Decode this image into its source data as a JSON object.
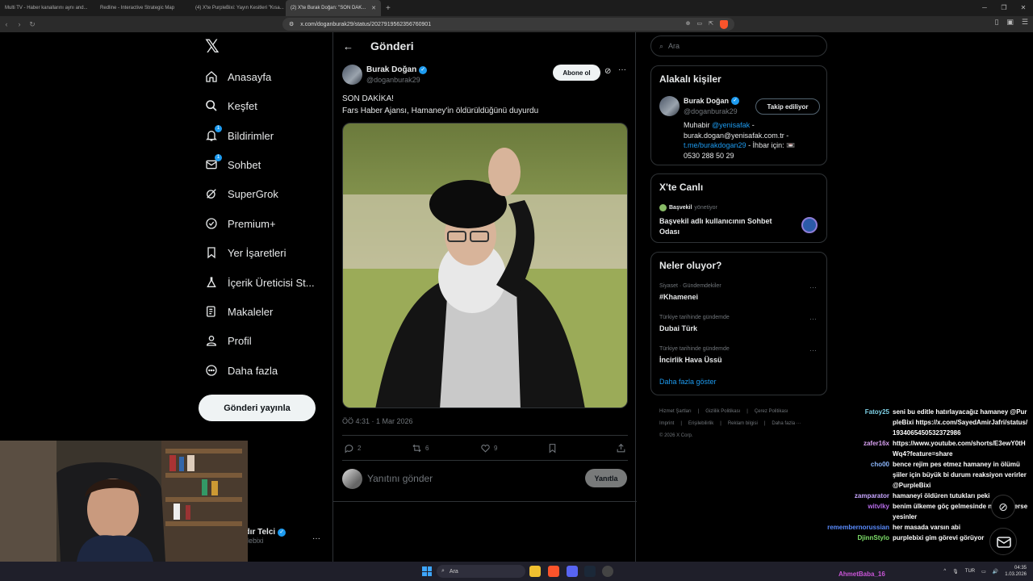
{
  "browser": {
    "tabs": [
      {
        "title": "Multi TV - Haber kanallarını aynı and...",
        "active": false
      },
      {
        "title": "Redline - Interactive Strategic Map",
        "active": false
      },
      {
        "title": "(4) X'te PurpleBixi: Yayın Kesitleri \"Kısa...",
        "active": false
      },
      {
        "title": "(2) X'te Burak Doğan: \"SON DAK...",
        "active": true
      }
    ],
    "url": "x.com/doganburak29/status/2027919562356760901"
  },
  "nav": {
    "items": [
      {
        "label": "Anasayfa",
        "icon": "home-icon"
      },
      {
        "label": "Keşfet",
        "icon": "search-icon"
      },
      {
        "label": "Bildirimler",
        "icon": "bell-icon",
        "badge": "1"
      },
      {
        "label": "Sohbet",
        "icon": "mail-icon",
        "badge": "1"
      },
      {
        "label": "SuperGrok",
        "icon": "grok-icon"
      },
      {
        "label": "Premium+",
        "icon": "verified-icon"
      },
      {
        "label": "Yer İşaretleri",
        "icon": "bookmark-icon"
      },
      {
        "label": "İçerik Üreticisi St...",
        "icon": "flask-icon"
      },
      {
        "label": "Makaleler",
        "icon": "article-icon"
      },
      {
        "label": "Profil",
        "icon": "person-icon"
      },
      {
        "label": "Daha fazla",
        "icon": "more-circle-icon"
      }
    ],
    "post_button": "Gönderi yayınla",
    "account_name": "adır Telci",
    "account_handle": "rplebixi"
  },
  "main": {
    "header_title": "Gönderi",
    "author": {
      "name": "Burak Doğan",
      "handle": "@doganburak29"
    },
    "subscribe_label": "Abone ol",
    "text_line1": "SON DAKİKA!",
    "text_line2": "Fars Haber Ajansı, Hamaney'in öldürüldüğünü duyurdu",
    "meta": "ÖÖ 4:31 · 1 Mar 2026",
    "actions": {
      "replies": "2",
      "reposts": "6",
      "likes": "9"
    },
    "reply_placeholder": "Yanıtını gönder",
    "reply_button": "Yanıtla"
  },
  "right": {
    "search_placeholder": "Ara",
    "related": {
      "title": "Alakalı kişiler",
      "name": "Burak Doğan",
      "handle": "@doganburak29",
      "follow_label": "Takip ediliyor",
      "bio_prefix": "Muhabir ",
      "bio_mention": "@yenisafak",
      "bio_mid": " - burak.dogan@yenisafak.com.tr - ",
      "bio_link": "t.me/burakdogan29",
      "bio_suffix": " - İhbar için: 📼",
      "bio_phone": "0530 288 50 29"
    },
    "live": {
      "title": "X'te Canlı",
      "host": "Başvekil",
      "host_suffix": "yönetiyor",
      "room_title": "Başvekil adlı kullanıcının Sohbet Odası"
    },
    "trends": {
      "title": "Neler oluyor?",
      "items": [
        {
          "category": "Siyaset · Gündemdekiler",
          "name": "#Khamenei"
        },
        {
          "category": "Türkiye tarihinde gündemde",
          "name": "Dubai Türk"
        },
        {
          "category": "Türkiye tarihinde gündemde",
          "name": "İncirlik Hava Üssü"
        }
      ],
      "show_more": "Daha fazla göster"
    },
    "footer": {
      "line1": [
        "Hizmet Şartları",
        "Gizlilik Politikası",
        "Çerez Politikası"
      ],
      "line2": [
        "Imprint",
        "Erişilebilirlik",
        "Reklam bilgisi",
        "Daha fazla ···"
      ],
      "line3": "© 2026 X Corp."
    }
  },
  "chat": {
    "messages": [
      {
        "user": "Fatoy25",
        "color": "#7fd3e8",
        "text": "seni bu editle hatırlayacağız hamaney @PurpleBixi https://x.com/SayedAmirJafri/status/1934065450532372986"
      },
      {
        "user": "zafer16x",
        "color": "#d7a0f0",
        "text": "https://www.youtube.com/shorts/E3ewY0tHWq4?feature=share"
      },
      {
        "user": "cho00",
        "color": "#8ab4f8",
        "text": "bence rejim pes etmez hamaney in ölümü şiiler için büyük bi durum reaksiyon verirler @PurpleBixi"
      },
      {
        "user": "zamparator",
        "color": "#c7a6ff",
        "text": "hamaneyi öldüren tutukları peki"
      },
      {
        "user": "witvlky",
        "color": "#b66be8",
        "text": "benim ülkeme göç gelmesinde ne bok yerse yesinler"
      },
      {
        "user": "remembernorussian",
        "color": "#5a8cff",
        "text": "her masada varsın abi"
      },
      {
        "user": "DjinnStylo",
        "color": "#7ee06a",
        "text": "purplebixi gim görevi görüyor"
      }
    ],
    "pending_user": "AhmetBaba_16"
  },
  "taskbar": {
    "search_label": "Ara",
    "lang": "TUR",
    "time": "04:35",
    "date": "1.03.2026"
  }
}
